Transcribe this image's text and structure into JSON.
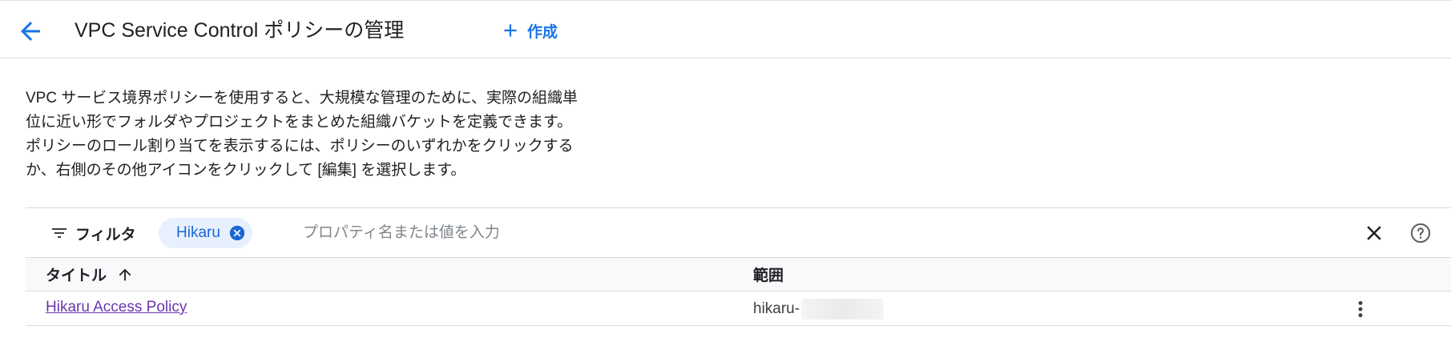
{
  "header": {
    "title": "VPC Service Control ポリシーの管理",
    "create_label": "作成",
    "icons": {
      "back": "arrow-back-icon",
      "create": "plus-icon"
    }
  },
  "description": {
    "lines": [
      "VPC サービス境界ポリシーを使用すると、大規模な管理のために、実際の組織単",
      "位に近い形でフォルダやプロジェクトをまとめた組織バケットを定義できます。",
      "ポリシーのロール割り当てを表示するには、ポリシーのいずれかをクリックする",
      "か、右側のその他アイコンをクリックして [編集] を選択します。"
    ]
  },
  "filter": {
    "label": "フィルタ",
    "chip": "Hikaru",
    "placeholder": "プロパティ名または値を入力",
    "icons": {
      "filter": "filter-list-icon",
      "chip_remove": "cancel-circle-icon",
      "clear": "close-icon",
      "help": "help-circle-icon"
    }
  },
  "table": {
    "columns": {
      "title": "タイトル",
      "scope": "範囲"
    },
    "sort": {
      "column": "title",
      "direction": "ascending",
      "icon": "arrow-upward-icon"
    },
    "rows": [
      {
        "title": "Hikaru Access Policy",
        "scope": "hikaru-"
      }
    ],
    "row_menu_icon": "more-vert-icon"
  },
  "colors": {
    "accent": "#1a73e8",
    "chip_bg": "#e8f0fe",
    "chip_text": "#1967d2",
    "visited_link": "#6b35b0",
    "divider": "#dadce0"
  }
}
